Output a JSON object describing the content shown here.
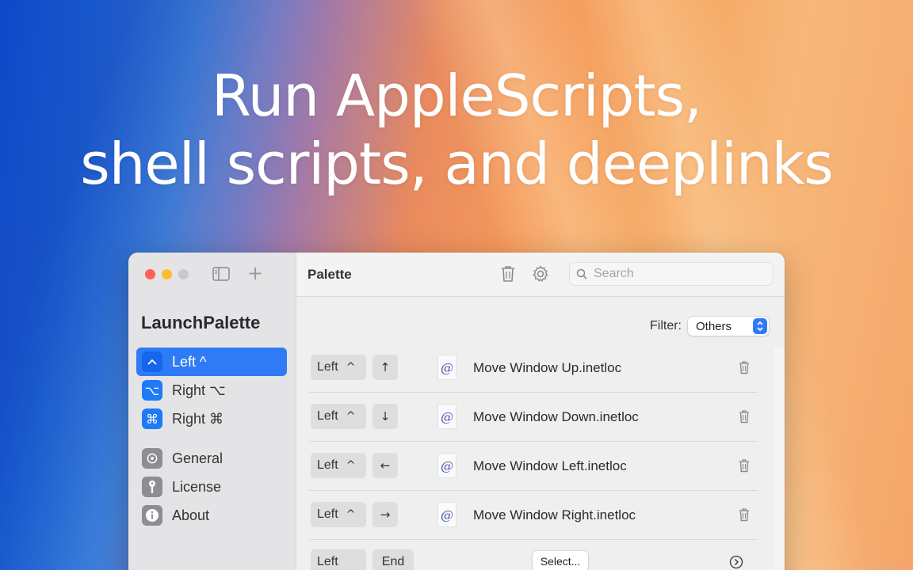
{
  "headline": {
    "line1": "Run AppleScripts,",
    "line2": "shell scripts, and deeplinks"
  },
  "sidebar": {
    "app_title": "LaunchPalette",
    "items": [
      {
        "label": "Left ^",
        "icon": "^",
        "icon_name": "control-key-icon",
        "active": true
      },
      {
        "label": "Right ⌥",
        "icon": "⌥",
        "icon_name": "option-key-icon",
        "active": false
      },
      {
        "label": "Right ⌘",
        "icon": "⌘",
        "icon_name": "command-key-icon",
        "active": false
      },
      {
        "label": "General",
        "icon_name": "gear-icon",
        "active": false
      },
      {
        "label": "License",
        "icon_name": "key-icon",
        "active": false
      },
      {
        "label": "About",
        "icon_name": "info-icon",
        "active": false
      }
    ]
  },
  "toolbar": {
    "title": "Palette",
    "search_placeholder": "Search"
  },
  "filter": {
    "label": "Filter:",
    "selected": "Others"
  },
  "rows": [
    {
      "modifier": "Left",
      "caret": "^",
      "key": "↑",
      "icon": "@",
      "file": "Move Window Up.inetloc"
    },
    {
      "modifier": "Left",
      "caret": "^",
      "key": "↓",
      "icon": "@",
      "file": "Move Window Down.inetloc"
    },
    {
      "modifier": "Left",
      "caret": "^",
      "key": "←",
      "icon": "@",
      "file": "Move Window Left.inetloc"
    },
    {
      "modifier": "Left",
      "caret": "^",
      "key": "→",
      "icon": "@",
      "file": "Move Window Right.inetloc"
    }
  ],
  "last_row": {
    "modifier": "Left",
    "key": "End",
    "select_label": "Select..."
  },
  "colors": {
    "accent": "#2f7bf6",
    "close": "#fe5f57",
    "minimize": "#febc2e"
  }
}
